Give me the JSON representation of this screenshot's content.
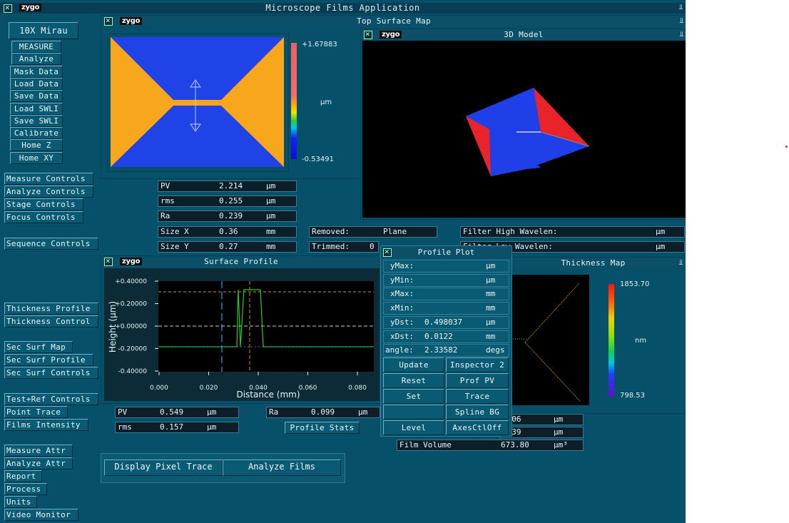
{
  "app_title": "Microscope Films Application",
  "brand": "zygo",
  "objective": "10X  Mirau",
  "left_buttons": [
    "MEASURE",
    "Analyze",
    "Mask Data",
    "Load Data",
    "Save Data",
    "Load SWLI",
    "Save SWLI",
    "Calibrate",
    "Home Z",
    "Home XY"
  ],
  "controls_group1": [
    "Measure Controls",
    "Analyze Controls",
    "Stage Controls",
    "Focus Controls"
  ],
  "controls_group2": [
    "Sequence Controls"
  ],
  "controls_group3": [
    "Thickness Profile",
    "Thickness Control"
  ],
  "controls_group4": [
    "Sec Surf Map",
    "Sec Surf Profile",
    "Sec Surf Controls"
  ],
  "controls_group5": [
    "Test+Ref Controls",
    "Point Trace",
    "Films Intensity"
  ],
  "controls_group6": [
    "Measure Attr",
    "Analyze Attr",
    "Report",
    "Process",
    "Units",
    "Video Monitor"
  ],
  "top_surface_map": {
    "title": "Top Surface Map",
    "scale_max": "+1.67883",
    "scale_min": "-0.53491",
    "unit": "µm",
    "colors": {
      "low": "#1f43e6",
      "high": "#f8a71c"
    }
  },
  "model_3d": {
    "title": "3D Model"
  },
  "stats": [
    {
      "label": "PV",
      "value": "2.214",
      "unit": "µm"
    },
    {
      "label": "rms",
      "value": "0.255",
      "unit": "µm"
    },
    {
      "label": "Ra",
      "value": "0.239",
      "unit": "µm"
    },
    {
      "label": "Size X",
      "value": "0.36",
      "unit": "mm"
    },
    {
      "label": "Size Y",
      "value": "0.27",
      "unit": "mm"
    }
  ],
  "removed": {
    "label": "Removed:",
    "value": "Plane"
  },
  "trimmed": {
    "label": "Trimmed:",
    "value": "0"
  },
  "filter_high": {
    "label": "Filter High Wavelen:",
    "unit": "µm"
  },
  "filter_low": {
    "label": "Filter Low  Wavelen:",
    "unit": "µm"
  },
  "surface_profile": {
    "title": "Surface Profile",
    "xlabel": "Distance (mm)",
    "ylabel": "Height (µm)",
    "yticks": [
      "+0.40000",
      "+0.20000",
      "+0.00000",
      "-0.20000",
      "-0.40000"
    ],
    "xticks": [
      "0.000",
      "0.020",
      "0.040",
      "0.060",
      "0.080"
    ]
  },
  "profile_stats": [
    {
      "label": "PV",
      "value": "0.549",
      "unit": "µm"
    },
    {
      "label": "rms",
      "value": "0.157",
      "unit": "µm"
    },
    {
      "label": "Ra",
      "value": "0.099",
      "unit": "µm"
    }
  ],
  "profile_stats_button": "Profile Stats",
  "profile_plot": {
    "title": "Profile Plot",
    "rows": [
      {
        "label": "yMax:",
        "value": "",
        "unit": "µm"
      },
      {
        "label": "yMin:",
        "value": "",
        "unit": "µm"
      },
      {
        "label": "xMax:",
        "value": "",
        "unit": "mm"
      },
      {
        "label": "xMin:",
        "value": "",
        "unit": "mm"
      },
      {
        "label": "yDst:",
        "value": "0.498037",
        "unit": "µm"
      },
      {
        "label": "xDst:",
        "value": "0.0122",
        "unit": "mm"
      },
      {
        "label": "angle:",
        "value": "2.33582",
        "unit": "degs"
      }
    ],
    "buttons": [
      [
        "Update",
        "Inspector 2"
      ],
      [
        "Reset",
        "Prof PV"
      ],
      [
        "Set",
        "Trace"
      ],
      [
        "",
        "Spline BG"
      ],
      [
        "Level",
        "AxesCtlOff"
      ]
    ]
  },
  "thickness_map": {
    "title": "Thickness Map",
    "scale_max": "1853.70",
    "scale_min": "798.53",
    "unit": "nm"
  },
  "thickness_stats": [
    {
      "value": "1.06",
      "unit": "µm"
    },
    {
      "value": "1.39",
      "unit": "µm"
    }
  ],
  "film_volume": {
    "label": "Film Volume",
    "value": "673.80",
    "unit": "µm³"
  },
  "bottom_buttons": [
    "Display Pixel Trace",
    "Analyze Films"
  ]
}
